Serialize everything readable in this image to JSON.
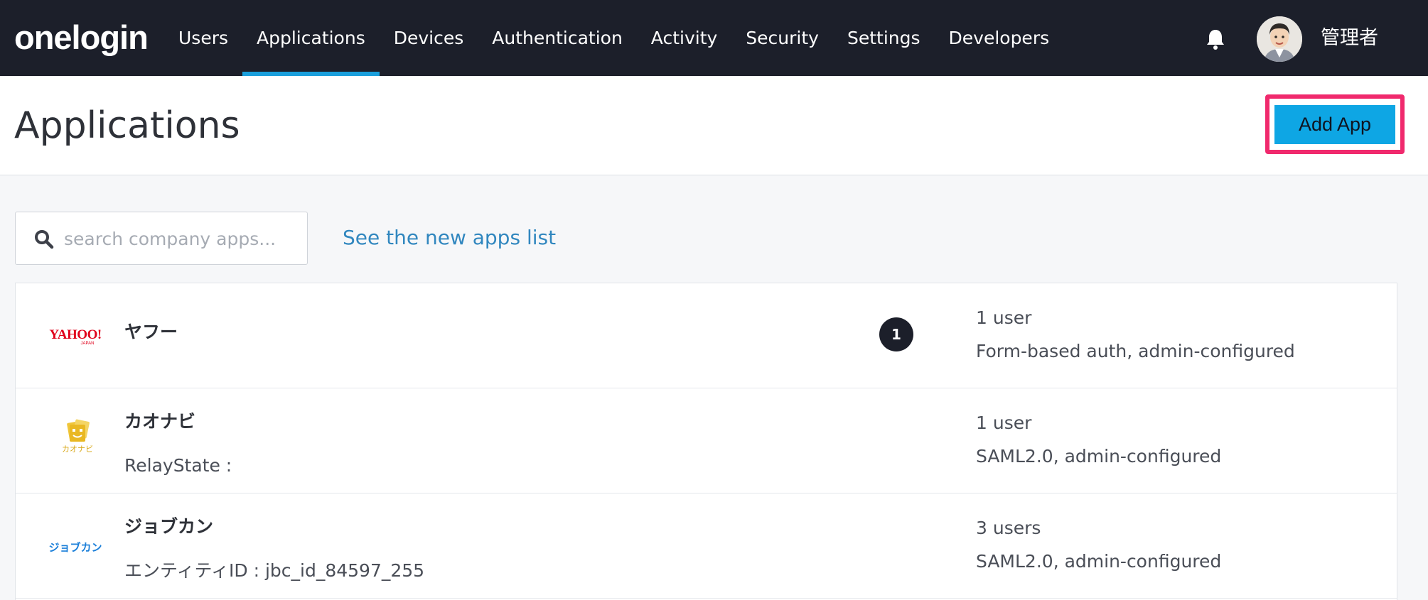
{
  "brand": {
    "logo_text": "onelogin",
    "accent": "#1a9fdc",
    "topbar_color": "#1c1f2a"
  },
  "nav": {
    "items": [
      {
        "label": "Users"
      },
      {
        "label": "Applications",
        "active": true
      },
      {
        "label": "Devices"
      },
      {
        "label": "Authentication"
      },
      {
        "label": "Activity"
      },
      {
        "label": "Security"
      },
      {
        "label": "Settings"
      },
      {
        "label": "Developers"
      }
    ]
  },
  "user": {
    "name": "管理者",
    "avatar_icon": "user-avatar",
    "notification_icon": "bell-icon"
  },
  "page": {
    "title": "Applications",
    "add_button_label": "Add App",
    "add_button_color": "#0ea6e4",
    "highlight_color": "#f0296d"
  },
  "search": {
    "placeholder": "search company apps...",
    "value": "",
    "icon": "search-icon"
  },
  "new_apps_link": "See the new apps list",
  "apps": [
    {
      "logo": "yahoo-japan-logo",
      "logo_text": "YAHOO! JAPAN",
      "name": "ヤフー",
      "description": "",
      "badge": "1",
      "users": "1 user",
      "auth": "Form-based auth, admin-configured"
    },
    {
      "logo": "kaonavi-logo",
      "logo_text": "カオナビ",
      "name": "カオナビ",
      "description": "RelayState :",
      "badge": "",
      "users": "1 user",
      "auth": "SAML2.0, admin-configured"
    },
    {
      "logo": "jobcan-logo",
      "logo_text": "ジョブカン",
      "name": "ジョブカン",
      "description": "エンティティID : jbc_id_84597_255",
      "badge": "",
      "users": "3 users",
      "auth": "SAML2.0, admin-configured"
    }
  ]
}
